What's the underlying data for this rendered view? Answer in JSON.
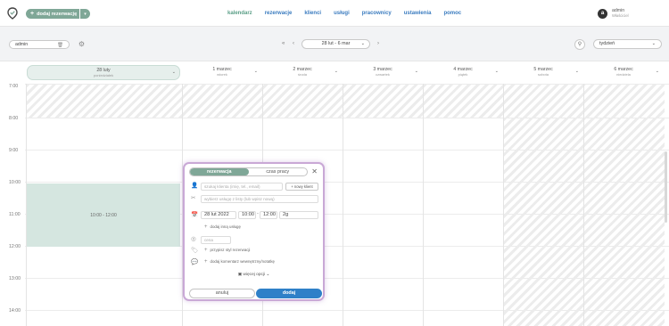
{
  "header": {
    "add_reservation": "dodaj rezerwację",
    "nav": [
      "kalendarz",
      "rezerwacje",
      "klienci",
      "usługi",
      "pracownicy",
      "ustawienia",
      "pomoc"
    ],
    "user": {
      "initial": "a",
      "name": "admin",
      "role": "Właściciel"
    }
  },
  "toolbar": {
    "employee": "admin",
    "date_range": "28 lut - 6 mar",
    "view": "tydzień"
  },
  "calendar": {
    "days": [
      {
        "date": "28 luty",
        "weekday": "poniedziałek"
      },
      {
        "date": "1 marzec",
        "weekday": "wtorek"
      },
      {
        "date": "2 marzec",
        "weekday": "środa"
      },
      {
        "date": "3 marzec",
        "weekday": "czwartek"
      },
      {
        "date": "4 marzec",
        "weekday": "piątek"
      },
      {
        "date": "5 marzec",
        "weekday": "sobota"
      },
      {
        "date": "6 marzec",
        "weekday": "niedziela"
      }
    ],
    "hours": [
      "7:00",
      "8:00",
      "9:00",
      "10:00",
      "11:00",
      "12:00",
      "13:00",
      "14:00"
    ],
    "event_label": "10:00 - 12:00"
  },
  "modal": {
    "tab_reservation": "rezerwacja",
    "tab_worktime": "czas pracy",
    "client_placeholder": "szukaj klienta (imię, tel., email)",
    "new_client": "+ nowy klient",
    "service_placeholder": "wybierz usługę z listy (lub wpisz nową)",
    "date": "28 lut 2022",
    "time_from": "10:00",
    "time_to": "12:00",
    "duration": "2g",
    "add_service": "dodaj inną usługę",
    "price_placeholder": "cena",
    "assign_style": "przypisz styl rezerwacji",
    "add_comment": "dodaj komentarz wewnętrzny/notatkę",
    "more_options": "więcej opcji",
    "cancel": "anuluj",
    "add": "dodaj"
  }
}
